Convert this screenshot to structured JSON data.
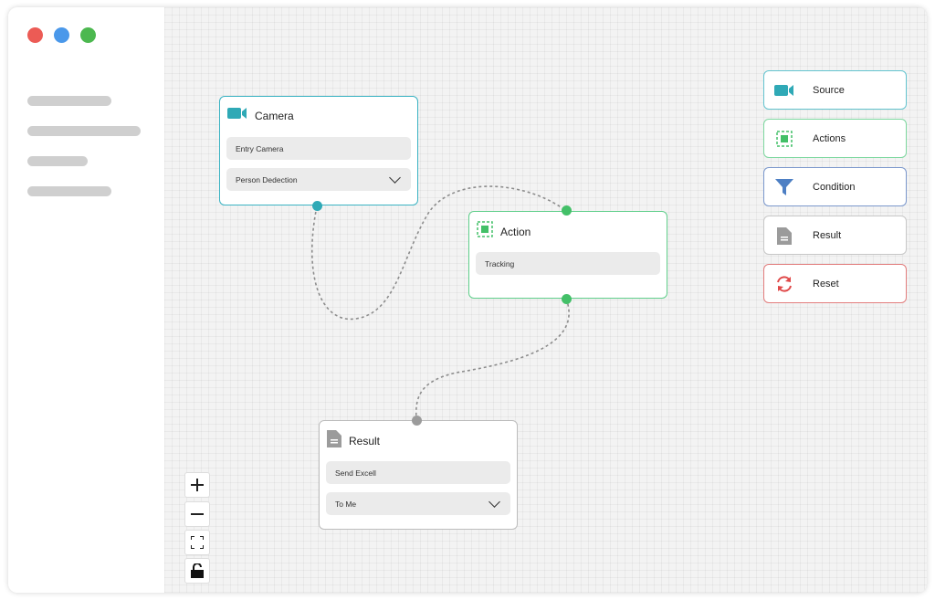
{
  "nodes": {
    "camera": {
      "title": "Camera",
      "field1": "Entry Camera",
      "select": "Person Dedection",
      "icon": "video-camera-icon"
    },
    "action": {
      "title": "Action",
      "field1": "Tracking",
      "icon": "tracking-square-icon"
    },
    "result": {
      "title": "Result",
      "field1": "Send Excell",
      "select": "To Me",
      "icon": "document-icon"
    }
  },
  "palette": {
    "source": {
      "label": "Source",
      "icon": "video-camera-icon"
    },
    "actions": {
      "label": "Actions",
      "icon": "tracking-square-icon"
    },
    "condition": {
      "label": "Condition",
      "icon": "filter-icon"
    },
    "result": {
      "label": "Result",
      "icon": "document-icon"
    },
    "reset": {
      "label": "Reset",
      "icon": "refresh-icon"
    }
  },
  "zoom_controls": [
    "zoom-in",
    "zoom-out",
    "fit-view",
    "lock"
  ],
  "colors": {
    "source": "#3bb3c3",
    "action": "#43c068",
    "condition": "#4d7fc4",
    "result": "#9b9b9b",
    "reset": "#e04848"
  }
}
